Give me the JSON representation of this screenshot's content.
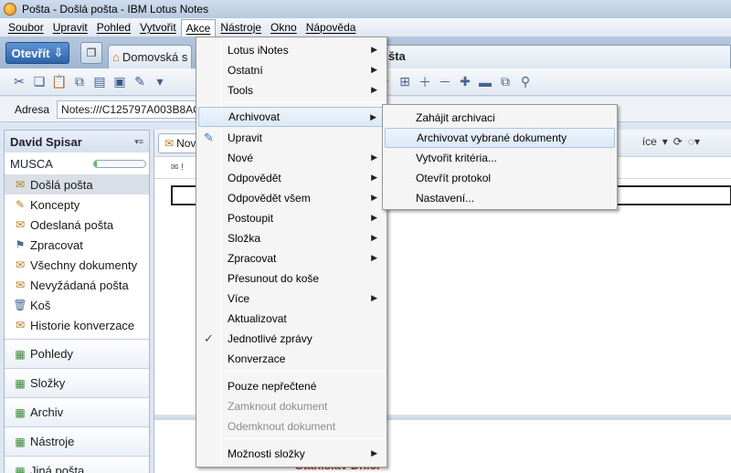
{
  "window": {
    "title": "Pošta - Došlá pošta - IBM Lotus Notes"
  },
  "menubar": [
    "Soubor",
    "Upravit",
    "Pohled",
    "Vytvořit",
    "Akce",
    "Nástroje",
    "Okno",
    "Nápověda"
  ],
  "tabs": {
    "open_label": "Otevřít",
    "home_label": "Domovská s",
    "mail_label": "šta"
  },
  "address": {
    "label": "Adresa",
    "value": "Notes:///C125797A003B8AC"
  },
  "sidebar": {
    "user": "David Spisar",
    "server": "MUSCA",
    "quota_fraction": 0.05,
    "items": [
      {
        "label": "Došlá pošta",
        "icon": "inbox-icon",
        "selected": true
      },
      {
        "label": "Koncepty",
        "icon": "drafts-icon"
      },
      {
        "label": "Odeslaná pošta",
        "icon": "sent-icon"
      },
      {
        "label": "Zpracovat",
        "icon": "followup-flag-icon"
      },
      {
        "label": "Všechny dokumenty",
        "icon": "all-documents-icon"
      },
      {
        "label": "Nevyžádaná pošta",
        "icon": "junk-icon"
      },
      {
        "label": "Koš",
        "icon": "trash-icon"
      },
      {
        "label": "Historie konverzace",
        "icon": "conversation-history-icon"
      }
    ],
    "sections": [
      {
        "label": "Pohledy",
        "icon": "views-icon"
      },
      {
        "label": "Složky",
        "icon": "folders-icon"
      },
      {
        "label": "Archiv",
        "icon": "archive-icon"
      },
      {
        "label": "Nástroje",
        "icon": "tools-icon"
      },
      {
        "label": "Jiná pošta",
        "icon": "other-mail-icon"
      }
    ]
  },
  "content": {
    "new_label": "Nov",
    "more_label": "íce",
    "preview_name": "Stanislav Dnlel"
  },
  "akce_menu": {
    "items": [
      {
        "label": "Lotus iNotes",
        "submenu": true
      },
      {
        "label": "Ostatní",
        "submenu": true
      },
      {
        "label": "Tools",
        "submenu": true
      },
      {
        "label": "Archivovat",
        "submenu": true,
        "highlighted": true
      },
      {
        "label": "Upravit",
        "icon": "edit-pencil-icon"
      },
      {
        "label": "Nové",
        "submenu": true
      },
      {
        "label": "Odpovědět",
        "submenu": true
      },
      {
        "label": "Odpovědět všem",
        "submenu": true
      },
      {
        "label": "Postoupit",
        "submenu": true
      },
      {
        "label": "Složka",
        "submenu": true
      },
      {
        "label": "Zpracovat",
        "submenu": true
      },
      {
        "label": "Přesunout do koše"
      },
      {
        "label": "Více",
        "submenu": true
      },
      {
        "label": "Aktualizovat"
      },
      {
        "label": "Jednotlivé zprávy",
        "checked": true
      },
      {
        "label": "Konverzace"
      },
      {
        "label": "Pouze nepřečtené"
      },
      {
        "label": "Zamknout dokument",
        "disabled": true
      },
      {
        "label": "Odemknout dokument",
        "disabled": true
      },
      {
        "label": "Možnosti složky",
        "submenu": true
      }
    ]
  },
  "archive_submenu": {
    "items": [
      {
        "label": "Zahájit archivaci"
      },
      {
        "label": "Archivovat vybrané dokumenty",
        "highlighted": true
      },
      {
        "label": "Vytvořit kritéria..."
      },
      {
        "label": "Otevřít protokol"
      },
      {
        "label": "Nastavení..."
      }
    ]
  }
}
